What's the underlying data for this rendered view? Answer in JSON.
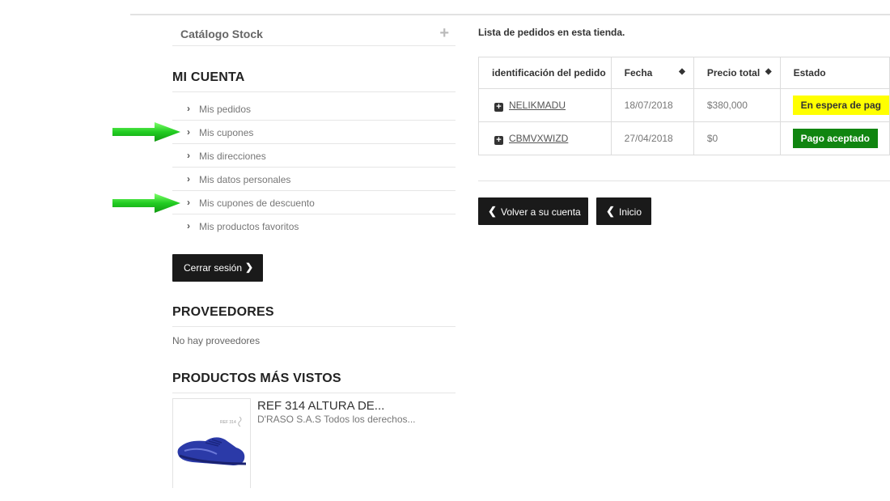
{
  "sidebar": {
    "catalog": {
      "title": "Catálogo Stock",
      "toggle": "+"
    },
    "account": {
      "title": "MI CUENTA",
      "items": [
        {
          "label": "Mis pedidos"
        },
        {
          "label": "Mis cupones"
        },
        {
          "label": "Mis direcciones"
        },
        {
          "label": "Mis datos personales"
        },
        {
          "label": "Mis cupones de descuento"
        },
        {
          "label": "Mis productos favoritos"
        }
      ],
      "logout_label": "Cerrar sesión"
    },
    "suppliers": {
      "title": "PROVEEDORES",
      "empty_text": "No hay proveedores"
    },
    "viewed": {
      "title": "PRODUCTOS MÁS VISTOS",
      "product": {
        "name": "REF 314 ALTURA DE...",
        "desc": "D'RASO S.A.S Todos los derechos...",
        "thumb_tag": "REF 314"
      }
    }
  },
  "orders": {
    "caption": "Lista de pedidos en esta tienda.",
    "headers": {
      "reference": "identificación del pedido",
      "date": "Fecha",
      "total": "Precio total",
      "status": "Estado"
    },
    "rows": [
      {
        "reference": "NELIKMADU",
        "date": "18/07/2018",
        "total": "$380,000",
        "status": "En espera de pag"
      },
      {
        "reference": "CBMVXWIZD",
        "date": "27/04/2018",
        "total": "$0",
        "status": "Pago aceptado"
      }
    ],
    "back_account_label": "Volver a su cuenta",
    "home_label": "Inicio"
  },
  "colors": {
    "accent_arrow": "#22cc22",
    "badge_waiting": "#ffff00",
    "badge_accepted": "#108510",
    "button_dark": "#1a1a1a"
  }
}
